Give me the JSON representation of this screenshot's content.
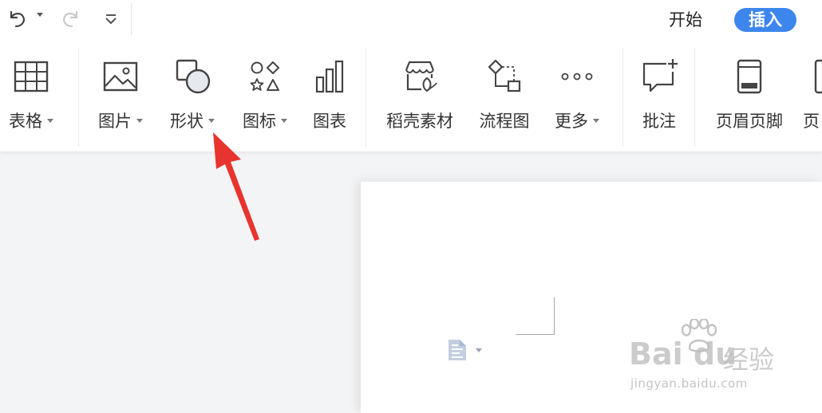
{
  "quick_access": {
    "undo_icon": "undo-icon",
    "redo_icon": "redo-icon",
    "customize_icon": "customize-icon"
  },
  "menu": {
    "tabs": [
      {
        "label": "开始",
        "active": false
      },
      {
        "label": "插入",
        "active": true
      }
    ]
  },
  "ribbon": {
    "items": [
      {
        "label": "表格",
        "icon": "table-icon",
        "dropdown": true
      },
      {
        "label": "图片",
        "icon": "picture-icon",
        "dropdown": true
      },
      {
        "label": "形状",
        "icon": "shape-icon",
        "dropdown": true
      },
      {
        "label": "图标",
        "icon": "icon-library-icon",
        "dropdown": true
      },
      {
        "label": "图表",
        "icon": "chart-icon",
        "dropdown": false
      },
      {
        "label": "稻壳素材",
        "icon": "docer-material-icon",
        "dropdown": false
      },
      {
        "label": "流程图",
        "icon": "flowchart-icon",
        "dropdown": false
      },
      {
        "label": "更多",
        "icon": "more-icon",
        "dropdown": true
      },
      {
        "label": "批注",
        "icon": "comment-icon",
        "dropdown": false
      },
      {
        "label": "页眉页脚",
        "icon": "header-footer-icon",
        "dropdown": false
      },
      {
        "label": "页",
        "icon": "page-icon",
        "dropdown": false
      }
    ]
  },
  "watermark": {
    "logo": "Bai du",
    "brand": "经验",
    "url": "jingyan.baidu.com"
  },
  "colors": {
    "accent": "#3d86ee",
    "arrow": "#e8342e",
    "workspace": "#f3f4f6"
  }
}
